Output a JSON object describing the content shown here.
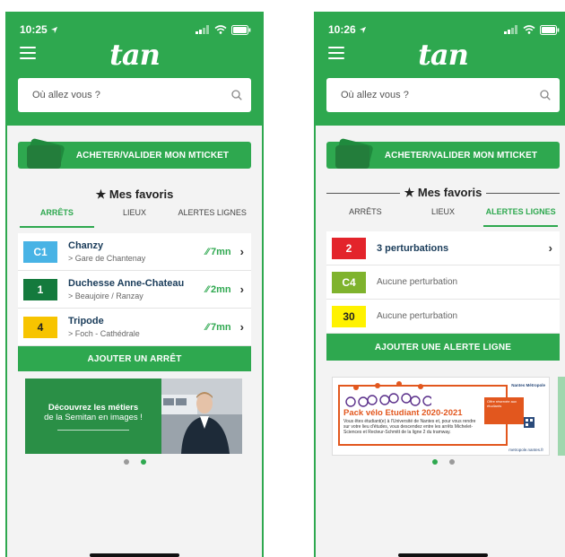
{
  "left": {
    "status": {
      "time": "10:25"
    },
    "logo": "tan",
    "search": {
      "placeholder": "Où allez vous ?"
    },
    "ticket_button": "ACHETER/VALIDER MON MTICKET",
    "favorites_title": "Mes favoris",
    "tabs": [
      "ARRÊTS",
      "LIEUX",
      "ALERTES LIGNES"
    ],
    "stops": [
      {
        "line": "C1",
        "name": "Chanzy",
        "direction": "> Gare de Chantenay",
        "eta": "7mn",
        "color": "#48b3e5",
        "text_color": "#ffffff"
      },
      {
        "line": "1",
        "name": "Duchesse Anne-Chateau",
        "direction": "> Beaujoire / Ranzay",
        "eta": "2mn",
        "color": "#147a3d",
        "text_color": "#ffffff"
      },
      {
        "line": "4",
        "name": "Tripode",
        "direction": "> Foch - Cathédrale",
        "eta": "7mn",
        "color": "#f7c400",
        "text_color": "#222222"
      }
    ],
    "add_button": "AJOUTER UN ARRÊT",
    "banner": {
      "line1": "Découvrez les métiers",
      "line2": "de la Semitan en images !"
    }
  },
  "right": {
    "status": {
      "time": "10:26"
    },
    "logo": "tan",
    "search": {
      "placeholder": "Où allez vous ?"
    },
    "ticket_button": "ACHETER/VALIDER MON MTICKET",
    "favorites_title": "Mes favoris",
    "tabs": [
      "ARRÊTS",
      "LIEUX",
      "ALERTES LIGNES"
    ],
    "alerts": [
      {
        "line": "2",
        "text": "3 perturbations",
        "color": "#e3242b",
        "text_color": "#ffffff",
        "bold": true
      },
      {
        "line": "C4",
        "text": "Aucune perturbation",
        "color": "#7fb32d",
        "text_color": "#ffffff",
        "bold": false
      },
      {
        "line": "30",
        "text": "Aucune perturbation",
        "color": "#fff200",
        "text_color": "#222222",
        "bold": false
      }
    ],
    "add_button": "AJOUTER UNE ALERTE LIGNE",
    "promo": {
      "title": "Pack vélo Etudiant 2020-2021",
      "body": "Vous êtes étudiant(e) à l'Université de Nantes et, pour vous rendre sur votre lieu d'études, vous descendez entre les arrêts Michelet-Sciences et Recteur-Schmitt de la ligne 2 du tramway.",
      "box": "Offre réservée aux étudiants",
      "brand": "Nantes Métropole",
      "site": "metropole.nantes.fr"
    }
  }
}
